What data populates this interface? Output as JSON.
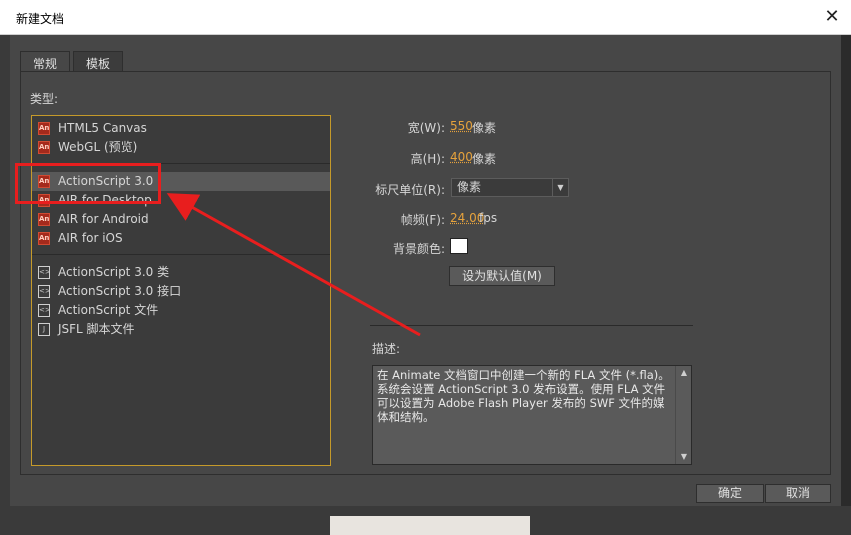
{
  "window": {
    "title": "新建文档"
  },
  "tabs": [
    {
      "label": "常规",
      "selected": true
    },
    {
      "label": "模板",
      "selected": false
    }
  ],
  "type_label": "类型:",
  "type_groups": [
    [
      {
        "label": "HTML5 Canvas",
        "icon": "animate-doc-icon"
      },
      {
        "label": "WebGL (预览)",
        "icon": "animate-doc-icon"
      }
    ],
    [
      {
        "label": "ActionScript 3.0",
        "icon": "animate-doc-icon",
        "selected": true
      },
      {
        "label": "AIR for Desktop",
        "icon": "animate-doc-icon"
      },
      {
        "label": "AIR for Android",
        "icon": "animate-doc-icon"
      },
      {
        "label": "AIR for iOS",
        "icon": "animate-doc-icon"
      }
    ],
    [
      {
        "label": "ActionScript 3.0 类",
        "icon": "script-file-icon"
      },
      {
        "label": "ActionScript 3.0 接口",
        "icon": "script-file-icon"
      },
      {
        "label": "ActionScript 文件",
        "icon": "script-file-icon"
      },
      {
        "label": "JSFL 脚本文件",
        "icon": "jsfl-file-icon"
      }
    ]
  ],
  "props": {
    "width_label": "宽(W):",
    "width_value": "550",
    "width_unit": "像素",
    "height_label": "高(H):",
    "height_value": "400",
    "height_unit": "像素",
    "ruler_label": "标尺单位(R):",
    "ruler_value": "像素",
    "fps_label": "帧频(F):",
    "fps_value": "24.00",
    "fps_unit": "fps",
    "bg_label": "背景颜色:",
    "bg_color": "#ffffff",
    "default_button": "设为默认值(M)"
  },
  "description": {
    "label": "描述:",
    "text": "在 Animate 文档窗口中创建一个新的 FLA 文件 (*.fla)。系统会设置 ActionScript 3.0 发布设置。使用 FLA 文件可以设置为 Adobe Flash Player 发布的 SWF 文件的媒体和结构。"
  },
  "buttons": {
    "ok": "确定",
    "cancel": "取消"
  },
  "colors": {
    "accent_border": "#c59a2a",
    "annotation": "#e81e1e",
    "value_orange": "#e6a23c"
  }
}
